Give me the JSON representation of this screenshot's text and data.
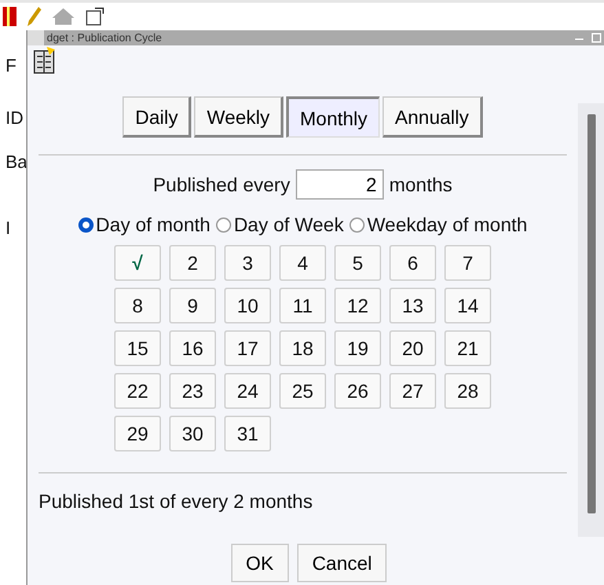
{
  "background_app": {
    "labels": [
      "F",
      "ID",
      "Ba",
      "I"
    ]
  },
  "dialog": {
    "title": "dget : Publication Cycle",
    "tabs": [
      {
        "label": "Daily",
        "selected": false
      },
      {
        "label": "Weekly",
        "selected": false
      },
      {
        "label": "Monthly",
        "selected": true
      },
      {
        "label": "Annually",
        "selected": false
      }
    ],
    "interval": {
      "label": "Published every",
      "value": "2",
      "unit": "months"
    },
    "modes": [
      {
        "label": "Day of month",
        "selected": true
      },
      {
        "label": "Day of Week",
        "selected": false
      },
      {
        "label": "Weekday of month",
        "selected": false
      }
    ],
    "days": [
      {
        "label": "√",
        "checked": true
      },
      {
        "label": "2",
        "checked": false
      },
      {
        "label": "3",
        "checked": false
      },
      {
        "label": "4",
        "checked": false
      },
      {
        "label": "5",
        "checked": false
      },
      {
        "label": "6",
        "checked": false
      },
      {
        "label": "7",
        "checked": false
      },
      {
        "label": "8",
        "checked": false
      },
      {
        "label": "9",
        "checked": false
      },
      {
        "label": "10",
        "checked": false
      },
      {
        "label": "11",
        "checked": false
      },
      {
        "label": "12",
        "checked": false
      },
      {
        "label": "13",
        "checked": false
      },
      {
        "label": "14",
        "checked": false
      },
      {
        "label": "15",
        "checked": false
      },
      {
        "label": "16",
        "checked": false
      },
      {
        "label": "17",
        "checked": false
      },
      {
        "label": "18",
        "checked": false
      },
      {
        "label": "19",
        "checked": false
      },
      {
        "label": "20",
        "checked": false
      },
      {
        "label": "21",
        "checked": false
      },
      {
        "label": "22",
        "checked": false
      },
      {
        "label": "23",
        "checked": false
      },
      {
        "label": "24",
        "checked": false
      },
      {
        "label": "25",
        "checked": false
      },
      {
        "label": "26",
        "checked": false
      },
      {
        "label": "27",
        "checked": false
      },
      {
        "label": "28",
        "checked": false
      },
      {
        "label": "29",
        "checked": false
      },
      {
        "label": "30",
        "checked": false
      },
      {
        "label": "31",
        "checked": false
      }
    ],
    "summary": "Published 1st of every 2 months",
    "buttons": [
      "OK",
      "Cancel"
    ]
  }
}
